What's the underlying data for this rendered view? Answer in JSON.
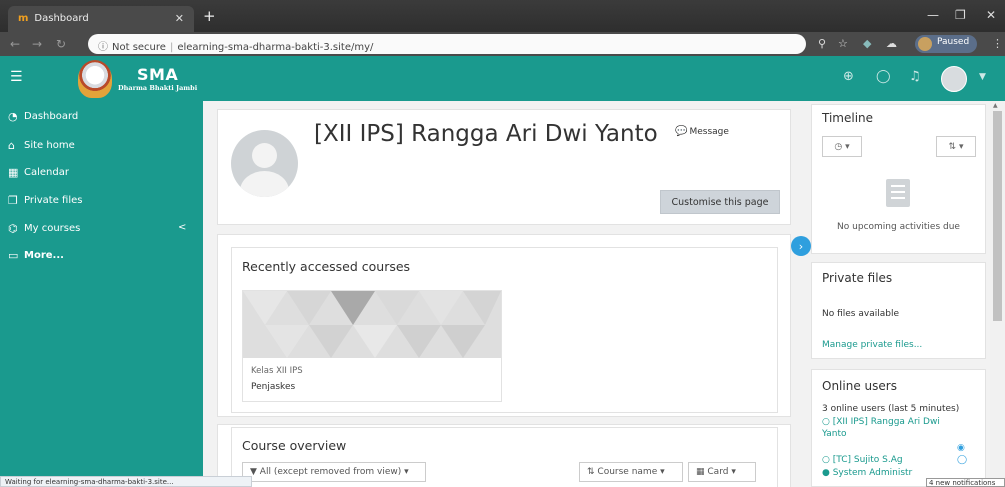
{
  "browser": {
    "tab_title": "Dashboard",
    "tab_favicon": "m",
    "url_secure_text": "Not secure",
    "url": "elearning-sma-dharma-bakti-3.site/my/",
    "profile_status": "Paused"
  },
  "navbar": {
    "brand_big": "SMA",
    "brand_small": "Dharma Bhakti Jambi",
    "colors": {
      "primary": "#1a9a8e",
      "accent": "#2f9fde"
    }
  },
  "drawer": {
    "items": [
      {
        "label": "Dashboard",
        "icon": "dashboard-icon"
      },
      {
        "label": "Site home",
        "icon": "home-icon"
      },
      {
        "label": "Calendar",
        "icon": "calendar-icon"
      },
      {
        "label": "Private files",
        "icon": "files-icon"
      },
      {
        "label": "My courses",
        "icon": "graduation-cap-icon"
      },
      {
        "label": "More...",
        "icon": "folder-icon"
      }
    ]
  },
  "profile": {
    "name": "[XII IPS] Rangga Ari Dwi Yanto",
    "message_label": "Message",
    "customise_label": "Customise this page"
  },
  "recent": {
    "title": "Recently accessed courses",
    "course_category": "Kelas XII IPS",
    "course_name": "Penjaskes"
  },
  "overview": {
    "title": "Course overview",
    "filter": "All (except removed from view)",
    "sort": "Course name",
    "view": "Card"
  },
  "timeline": {
    "title": "Timeline",
    "empty_text": "No upcoming activities due"
  },
  "private_files": {
    "title": "Private files",
    "empty_text": "No files available",
    "manage_link": "Manage private files..."
  },
  "online_users": {
    "title": "Online users",
    "summary": "3 online users (last 5 minutes)",
    "users": [
      "[XII IPS] Rangga Ari Dwi",
      "Yanto",
      "[TC] Sujito S.Ag",
      "System Administr"
    ]
  },
  "status": {
    "loading": "Waiting for elearning-sma-dharma-bakti-3.site...",
    "notifications": "4 new notifications"
  }
}
